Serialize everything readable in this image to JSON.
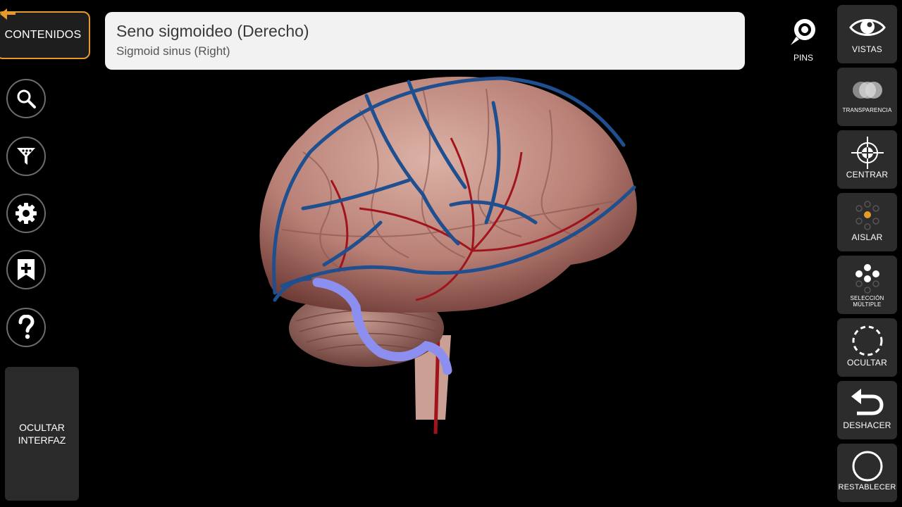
{
  "left_panel": {
    "contents_label": "CONTENIDOS",
    "hide_ui_label_line1": "OCULTAR",
    "hide_ui_label_line2": "INTERFAZ"
  },
  "title_bar": {
    "title": "Seno sigmoideo (Derecho)",
    "subtitle": "Sigmoid sinus (Right)"
  },
  "pins": {
    "label": "PINS"
  },
  "toolbar": {
    "views": "VISTAS",
    "transparency": "TRANSPARENCIA",
    "center": "CENTRAR",
    "isolate": "AISLAR",
    "multi_select": "SELECCIÓN MÚLTIPLE",
    "hide": "OCULTAR",
    "undo": "DESHACER",
    "reset": "RESTABLECER"
  },
  "colors": {
    "accent": "#e59a2b",
    "vein": "#1f4f8f",
    "artery": "#a1141c",
    "selected": "#8c8ff0",
    "brain": "#c9958b"
  }
}
